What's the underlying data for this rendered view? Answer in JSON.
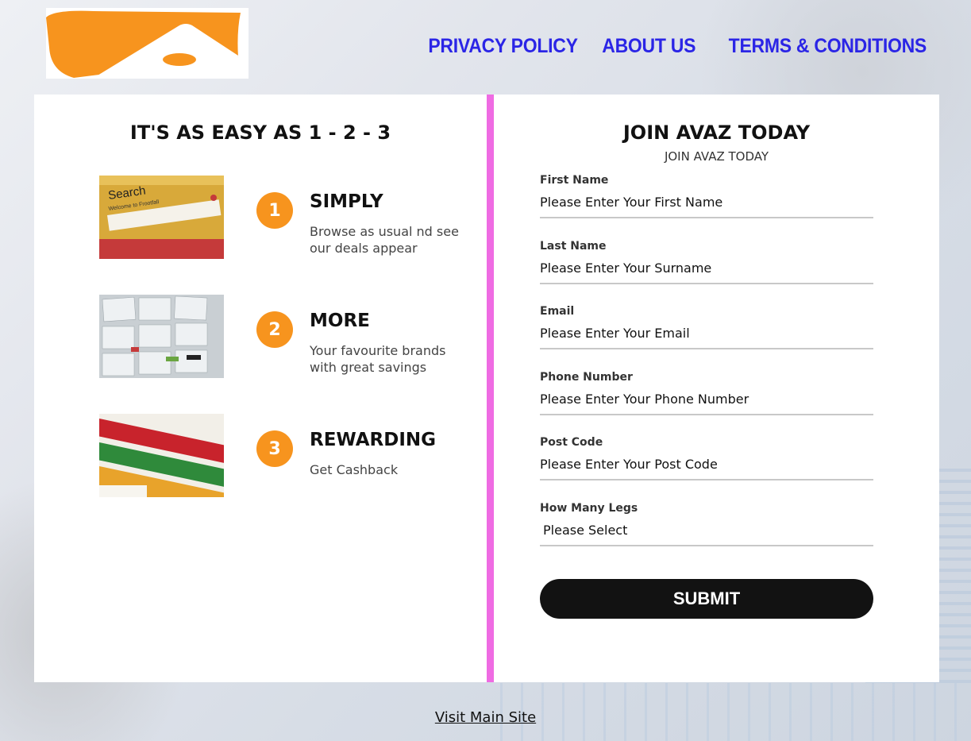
{
  "nav": {
    "logo_icon": "brand-logo-icon",
    "links": [
      "PRIVACY POLICY",
      "ABOUT US",
      "TERMS & CONDITIONS"
    ],
    "link_color": "#2b25e6"
  },
  "steps_panel": {
    "title": "IT'S AS EASY AS 1 - 2 - 3",
    "steps": [
      {
        "number": "1",
        "title": "SIMPLY",
        "description": "Browse as usual nd see our deals appear",
        "image_icon": "search-screenshot-image"
      },
      {
        "number": "2",
        "title": "MORE",
        "description": "Your favourite brands with great savings",
        "image_icon": "brand-offers-image"
      },
      {
        "number": "3",
        "title": "REWARDING",
        "description": "Get Cashback",
        "image_icon": "offer-banners-image"
      }
    ],
    "accent_color": "#f7941e"
  },
  "form": {
    "title": "JOIN AVAZ TODAY",
    "subtitle": "JOIN AVAZ TODAY",
    "fields": [
      {
        "label": "First Name",
        "placeholder": "Please Enter Your First Name"
      },
      {
        "label": "Last Name",
        "placeholder": "Please Enter Your Surname"
      },
      {
        "label": "Email",
        "placeholder": "Please Enter Your Email"
      },
      {
        "label": "Phone Number",
        "placeholder": "Please Enter Your Phone Number"
      },
      {
        "label": "Post Code",
        "placeholder": "Please Enter Your Post Code"
      }
    ],
    "select": {
      "label": "How Many Legs",
      "selected": "Please Select"
    },
    "submit_label": "SUBMIT",
    "divider_color": "#ef6be3"
  },
  "footer": {
    "link": "Visit Main Site"
  }
}
